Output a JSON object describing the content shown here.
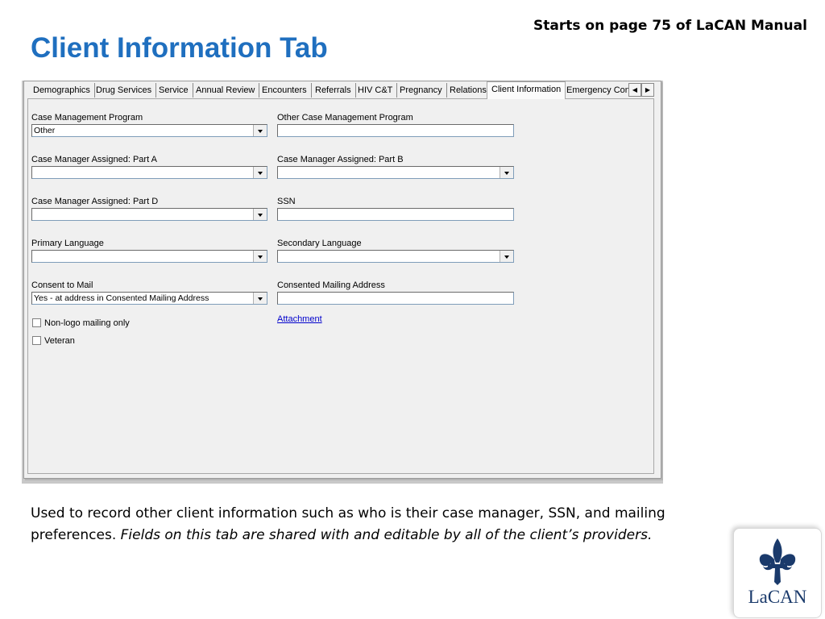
{
  "slide": {
    "title": "Client Information Tab",
    "reference": "Starts on page 75 of LaCAN Manual",
    "description_plain": "Used to record other client information such as who is their case manager, SSN, and mailing preferences.",
    "description_italic": "Fields on this tab are shared with and editable by all of the client’s providers.",
    "logo_text": "LaCAN"
  },
  "tabs": [
    "Demographics",
    "Drug Services",
    "Service",
    "Annual Review",
    "Encounters",
    "Referrals",
    "HIV C&T",
    "Pregnancy",
    "Relations",
    "Client Information",
    "Emergency Con"
  ],
  "active_tab": "Client Information",
  "form": {
    "case_management_program": {
      "label": "Case Management Program",
      "value": "Other"
    },
    "other_case_management_program": {
      "label": "Other Case Management Program",
      "value": ""
    },
    "case_manager_part_a": {
      "label": "Case Manager Assigned: Part A",
      "value": ""
    },
    "case_manager_part_b": {
      "label": "Case Manager Assigned: Part B",
      "value": ""
    },
    "case_manager_part_d": {
      "label": "Case Manager Assigned: Part D",
      "value": ""
    },
    "ssn": {
      "label": "SSN",
      "value": ""
    },
    "primary_language": {
      "label": "Primary Language",
      "value": ""
    },
    "secondary_language": {
      "label": "Secondary Language",
      "value": ""
    },
    "consent_to_mail": {
      "label": "Consent to Mail",
      "value": "Yes - at address in Consented Mailing Address"
    },
    "consented_mailing_address": {
      "label": "Consented Mailing Address",
      "value": ""
    },
    "non_logo_mailing": {
      "label": "Non-logo mailing only",
      "checked": false
    },
    "veteran": {
      "label": "Veteran",
      "checked": false
    },
    "attachment_link": "Attachment"
  },
  "colors": {
    "title": "#1f6fbf",
    "link": "#0000cc",
    "logo": "#1a3a6b"
  }
}
